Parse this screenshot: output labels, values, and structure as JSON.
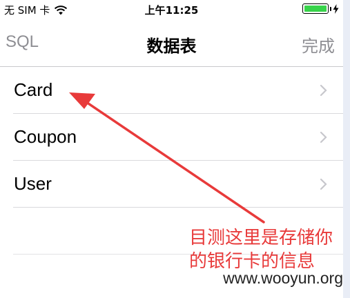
{
  "status_bar": {
    "carrier": "无 SIM 卡",
    "wifi_icon": "wifi-icon",
    "time": "上午11:25",
    "battery_percent": 100,
    "battery_color": "#37d34a",
    "charging_icon": "bolt-icon"
  },
  "nav": {
    "left_label": "SQL",
    "title": "数据表",
    "right_label": "完成"
  },
  "tables": [
    {
      "label": "Card"
    },
    {
      "label": "Coupon"
    },
    {
      "label": "User"
    }
  ],
  "annotation": {
    "line1": "目测这里是存储你",
    "line2": "的银行卡的信息",
    "color": "#e83a3a"
  },
  "watermark": "www.wooyun.org"
}
